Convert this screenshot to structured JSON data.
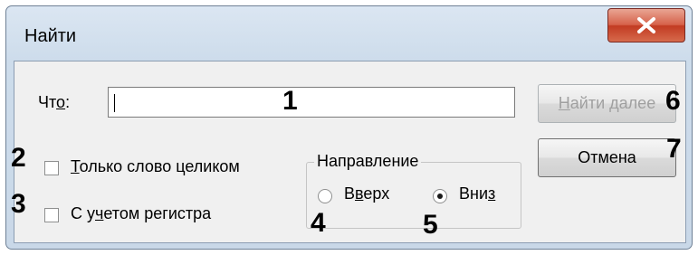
{
  "window": {
    "title": "Найти"
  },
  "find_what": {
    "label_before": "Чт",
    "label_accel": "о",
    "label_after": ":",
    "value": ""
  },
  "buttons": {
    "find_next_accel": "Н",
    "find_next_rest": "айти далее",
    "find_next_enabled": false,
    "cancel": "Отмена"
  },
  "options": {
    "whole_word_accel": "Т",
    "whole_word_rest": "олько слово целиком",
    "whole_word_checked": false,
    "match_case_before": "С у",
    "match_case_accel": "ч",
    "match_case_after": "етом регистра",
    "match_case_checked": false
  },
  "direction": {
    "label": "Направление",
    "up_before": "В",
    "up_accel": "в",
    "up_after": "ерх",
    "up_selected": false,
    "down_before": "Вни",
    "down_accel": "з",
    "down_after": "",
    "down_selected": true
  },
  "annotations": [
    "1",
    "2",
    "3",
    "4",
    "5",
    "6",
    "7"
  ],
  "colors": {
    "close_button": "#c9462c",
    "titlebar": "#d3e0ee",
    "dialog_face": "#f0f0f0",
    "disabled_text": "#a0a0a0"
  }
}
